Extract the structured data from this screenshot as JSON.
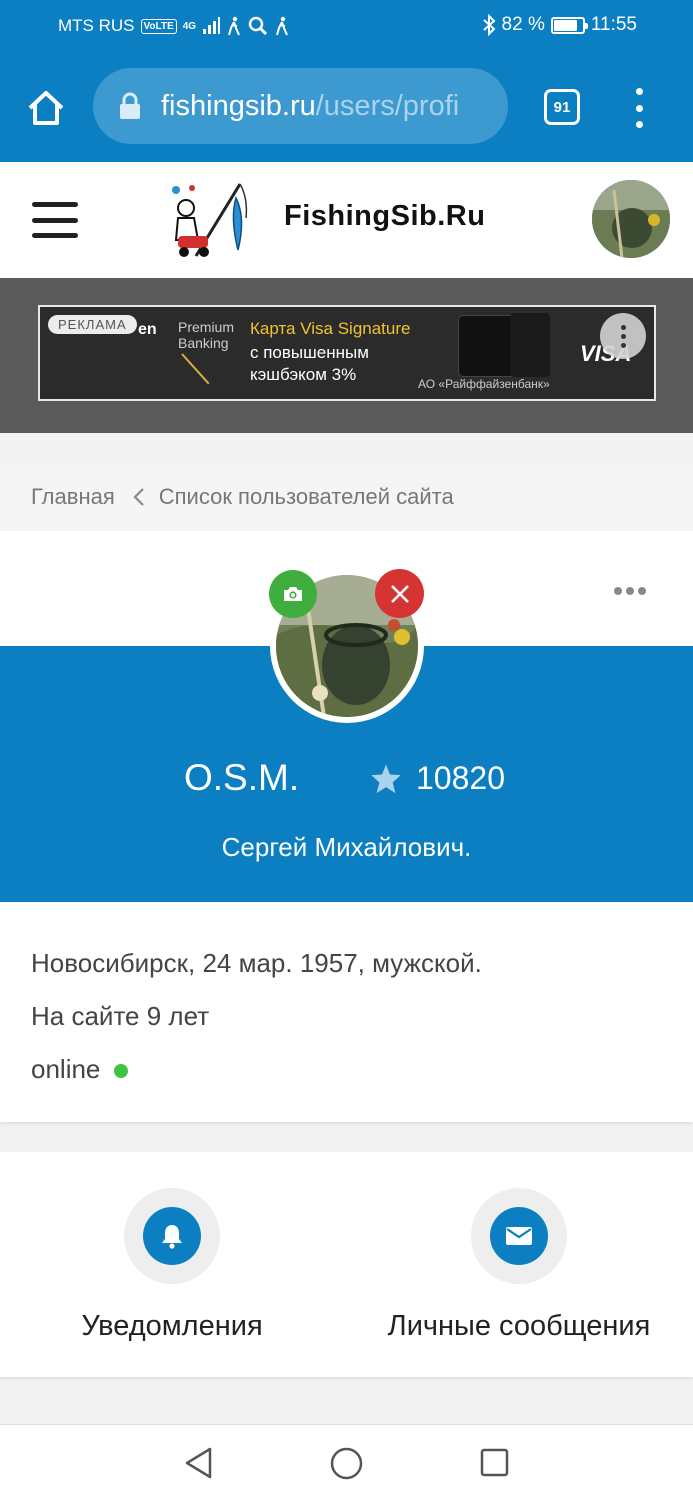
{
  "status_bar": {
    "carrier": "MTS RUS",
    "volte": "VoLTE",
    "network": "4G",
    "battery_text": "82 %",
    "battery_level": 0.82,
    "time": "11:55"
  },
  "browser": {
    "url_domain": "fishingsib.ru",
    "url_path": "/users/profi",
    "tab_count": "91"
  },
  "site": {
    "logo_text": "FishingSib.Ru"
  },
  "ad": {
    "tag": "РЕКЛАМА",
    "bank_fragment": "en",
    "premium_line1": "Premium",
    "premium_line2": "Banking",
    "title": "Карта Visa Signature",
    "line2": "с повышенным",
    "line3": "кэшбэком 3%",
    "bank_name": "АО «Райффайзенбанк»",
    "visa": "VISA"
  },
  "breadcrumb": {
    "home": "Главная",
    "current": "Список пользователей сайта"
  },
  "profile": {
    "username": "O.S.M.",
    "rating": "10820",
    "full_name": "Сергей Михайлович.",
    "details": "Новосибирск, 24 мар. 1957, мужской.",
    "membership": "На сайте 9 лет",
    "status": "online"
  },
  "actions": {
    "notifications": "Уведомления",
    "messages": "Личные сообщения"
  },
  "colors": {
    "brand_blue": "#0b7fc2",
    "online_green": "#3ec43e",
    "camera_green": "#3fae3f",
    "delete_red": "#d63333"
  }
}
